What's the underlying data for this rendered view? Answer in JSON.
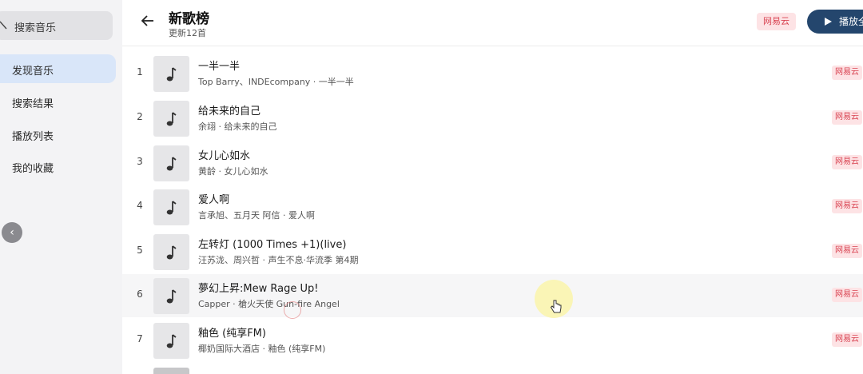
{
  "sidebar": {
    "search_label": "搜索音乐",
    "items": [
      {
        "label": "发现音乐",
        "active": true
      },
      {
        "label": "搜索结果",
        "active": false
      },
      {
        "label": "播放列表",
        "active": false
      },
      {
        "label": "我的收藏",
        "active": false
      }
    ],
    "collapse_glyph": "‹"
  },
  "header": {
    "title": "新歌榜",
    "subtitle": "更新12首",
    "source_tag": "网易云",
    "play_all_label": "播放全"
  },
  "songs": [
    {
      "index": "1",
      "name": "一半一半",
      "meta": "Top Barry、INDEcompany · 一半一半",
      "tag": "网易云"
    },
    {
      "index": "2",
      "name": "给未来的自己",
      "meta": "余翊 · 给未来的自己",
      "tag": "网易云"
    },
    {
      "index": "3",
      "name": "女儿心如水",
      "meta": "黄龄 · 女儿心如水",
      "tag": "网易云"
    },
    {
      "index": "4",
      "name": "爱人啊",
      "meta": "言承旭、五月天 阿信 · 爱人啊",
      "tag": "网易云"
    },
    {
      "index": "5",
      "name": "左转灯 (1000 Times +1)(live)",
      "meta": "汪苏泷、周兴哲 · 声生不息·华流季 第4期",
      "tag": "网易云"
    },
    {
      "index": "6",
      "name": "夢幻上昇:Mew Rage Up!",
      "meta": "Capper · 槍火天使 Gun-fire Angel",
      "tag": "网易云"
    },
    {
      "index": "7",
      "name": "釉色 (纯享FM)",
      "meta": "椰奶国际大酒店 · 釉色 (纯享FM)",
      "tag": "网易云"
    }
  ],
  "colors": {
    "accent": "#24466d",
    "active_nav": "#d9e6f9",
    "tag_bg": "#fde3e5",
    "tag_text": "#d94452"
  }
}
